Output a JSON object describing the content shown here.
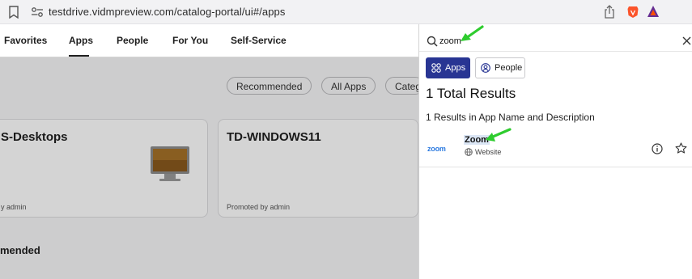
{
  "browser": {
    "url": "testdrive.vidmpreview.com/catalog-portal/ui#/apps",
    "icons": [
      "bookmark-icon",
      "site-settings-icon",
      "share-icon",
      "brave-shield-icon",
      "bat-rewards-icon"
    ]
  },
  "nav": {
    "items": [
      {
        "label": "Favorites"
      },
      {
        "label": "Apps",
        "active": true
      },
      {
        "label": "People"
      },
      {
        "label": "For You"
      },
      {
        "label": "Self-Service"
      }
    ]
  },
  "main": {
    "filters": [
      {
        "label": "Recommended"
      },
      {
        "label": "All Apps"
      },
      {
        "label": "Categ"
      }
    ],
    "cards": [
      {
        "title": "S-Desktops",
        "promo": "y admin"
      },
      {
        "title": "TD-WINDOWS11",
        "promo": "Promoted by admin"
      }
    ],
    "section_title": "mended"
  },
  "search": {
    "query": "zoom",
    "tabs": [
      {
        "label": "Apps",
        "icon": "apps-grid-icon",
        "selected": true
      },
      {
        "label": "People",
        "icon": "person-icon",
        "selected": false
      }
    ],
    "total_results": "1 Total Results",
    "subheading": "1 Results in App Name and Description",
    "results": [
      {
        "logo_text": "zoom",
        "name": "Zoom",
        "type": "Website"
      }
    ]
  },
  "colors": {
    "accent": "#283593",
    "annotation_arrow": "#2ecc2e",
    "zoom_blue": "#2d7be0"
  }
}
